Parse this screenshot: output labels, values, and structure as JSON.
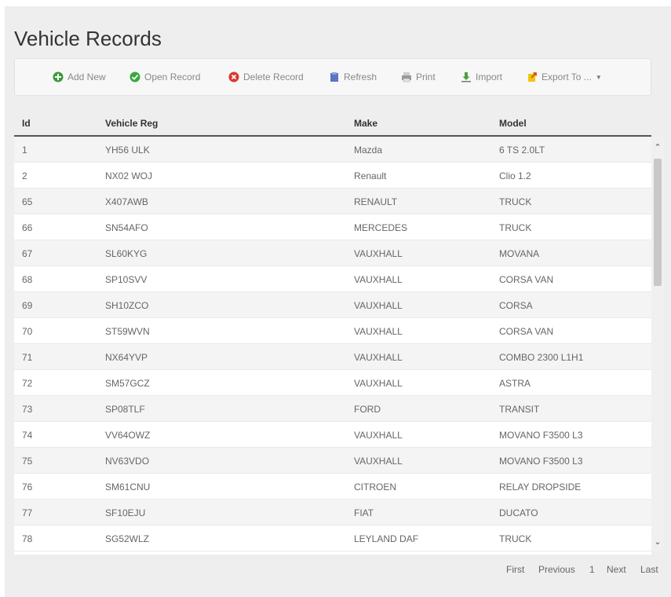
{
  "page": {
    "title": "Vehicle Records"
  },
  "toolbar": {
    "add_new": "Add New",
    "open_record": "Open Record",
    "delete_record": "Delete Record",
    "refresh": "Refresh",
    "print": "Print",
    "import": "Import",
    "export_to": "Export To ...",
    "colors": {
      "add": "#3a9a3a",
      "open": "#3aa83a",
      "delete": "#d9382f",
      "refresh": "#5b74c4",
      "import": "#4f9f3f",
      "export": "#d35400"
    }
  },
  "table": {
    "columns": [
      "Id",
      "Vehicle Reg",
      "Make",
      "Model"
    ],
    "rows": [
      [
        "1",
        "YH56 ULK",
        "Mazda",
        "6 TS 2.0LT"
      ],
      [
        "2",
        "NX02 WOJ",
        "Renault",
        "Clio 1.2"
      ],
      [
        "65",
        "X407AWB",
        "RENAULT",
        "TRUCK"
      ],
      [
        "66",
        "SN54AFO",
        "MERCEDES",
        "TRUCK"
      ],
      [
        "67",
        "SL60KYG",
        "VAUXHALL",
        "MOVANA"
      ],
      [
        "68",
        "SP10SVV",
        "VAUXHALL",
        "CORSA VAN"
      ],
      [
        "69",
        "SH10ZCO",
        "VAUXHALL",
        "CORSA"
      ],
      [
        "70",
        "ST59WVN",
        "VAUXHALL",
        "CORSA VAN"
      ],
      [
        "71",
        "NX64YVP",
        "VAUXHALL",
        "COMBO 2300 L1H1"
      ],
      [
        "72",
        "SM57GCZ",
        "VAUXHALL",
        "ASTRA"
      ],
      [
        "73",
        "SP08TLF",
        "FORD",
        "TRANSIT"
      ],
      [
        "74",
        "VV64OWZ",
        "VAUXHALL",
        "MOVANO F3500 L3"
      ],
      [
        "75",
        "NV63VDO",
        "VAUXHALL",
        "MOVANO F3500 L3"
      ],
      [
        "76",
        "SM61CNU",
        "CITROEN",
        "RELAY DROPSIDE"
      ],
      [
        "77",
        "SF10EJU",
        "FIAT",
        "DUCATO"
      ],
      [
        "78",
        "SG52WLZ",
        "LEYLAND DAF",
        "TRUCK"
      ]
    ]
  },
  "scrollbar": {
    "up_icon": "chevron-up-icon",
    "down_icon": "chevron-down-icon"
  },
  "pager": {
    "first": "First",
    "previous": "Previous",
    "page": "1",
    "next": "Next",
    "last": "Last"
  }
}
